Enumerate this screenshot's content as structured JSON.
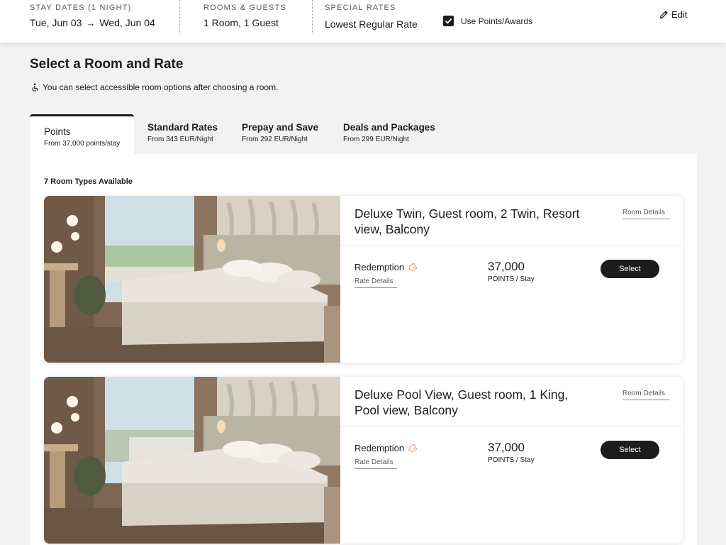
{
  "header": {
    "stay_dates_label": "STAY DATES (1 NIGHT)",
    "check_in": "Tue, Jun 03",
    "check_out": "Wed, Jun 04",
    "rooms_guests_label": "ROOMS & GUESTS",
    "rooms_guests_value": "1 Room, 1 Guest",
    "special_rates_label": "SPECIAL RATES",
    "special_rates_value": "Lowest Regular Rate",
    "use_points_label": "Use Points/Awards",
    "use_points_checked": true,
    "edit_label": "Edit"
  },
  "main": {
    "title": "Select a Room and Rate",
    "accessible_note": "You can select accessible room options after choosing a room.",
    "tabs": [
      {
        "title": "Points",
        "subtitle": "From 37,000 points/stay",
        "active": true
      },
      {
        "title": "Standard Rates",
        "subtitle": "From 343 EUR/Night",
        "active": false
      },
      {
        "title": "Prepay and Save",
        "subtitle": "From 292 EUR/Night",
        "active": false
      },
      {
        "title": "Deals and Packages",
        "subtitle": "From 299 EUR/Night",
        "active": false
      }
    ],
    "room_count": "7 Room Types Available",
    "rooms": [
      {
        "title": "Deluxe Twin, Guest room, 2 Twin, Resort view, Balcony",
        "room_details_label": "Room Details",
        "rate_name": "Redemption",
        "rate_details_label": "Rate Details",
        "points": "37,000",
        "points_unit": "POINTS / Stay",
        "select_label": "Select"
      },
      {
        "title": "Deluxe Pool View, Guest room, 1 King, Pool view, Balcony",
        "room_details_label": "Room Details",
        "rate_name": "Redemption",
        "rate_details_label": "Rate Details",
        "points": "37,000",
        "points_unit": "POINTS / Stay",
        "select_label": "Select"
      }
    ]
  },
  "colors": {
    "background": "#f2f2f2",
    "primary": "#1c1c1c",
    "tag_accent": "#e8a07a"
  }
}
